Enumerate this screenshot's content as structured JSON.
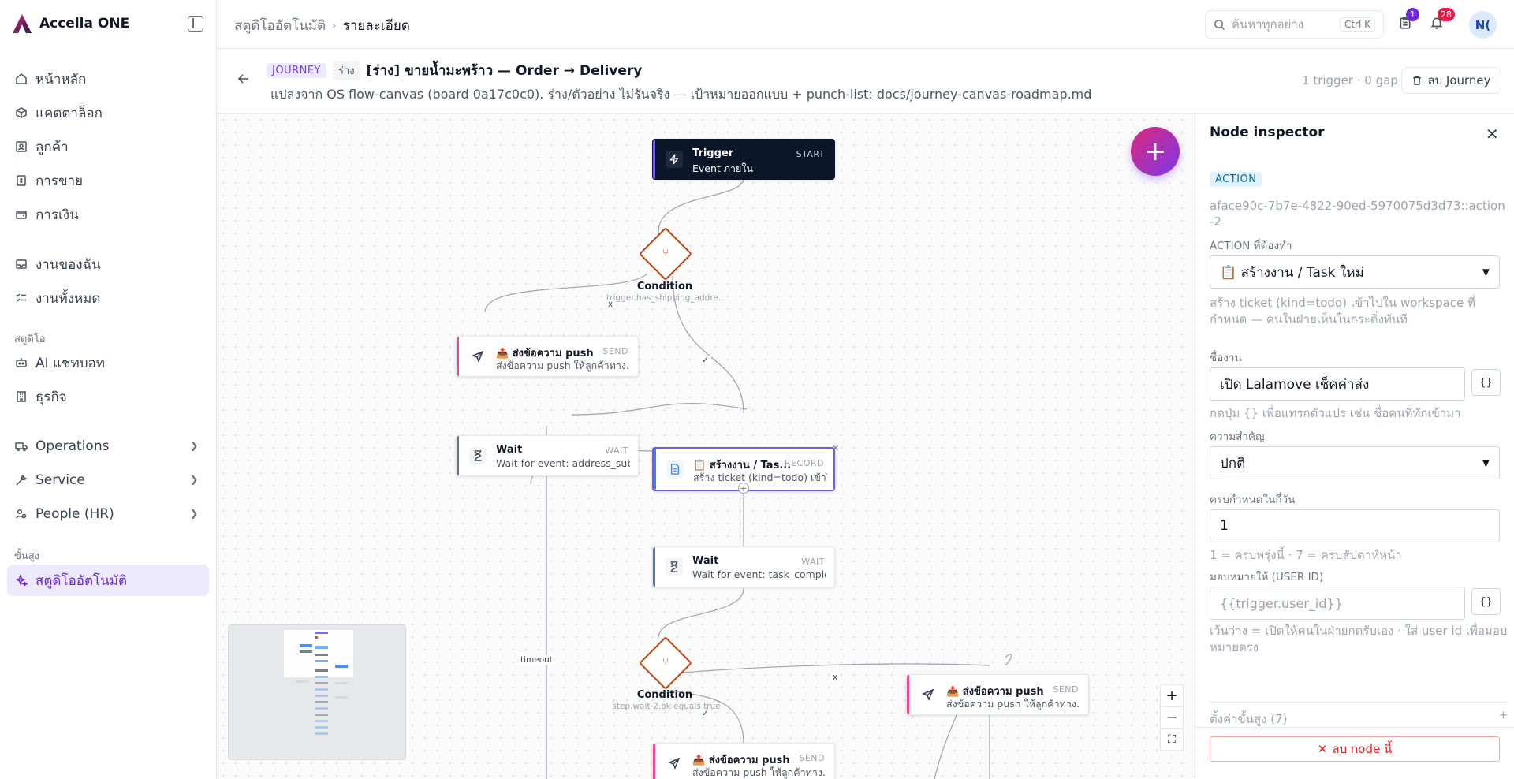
{
  "app": {
    "name": "Accella ONE"
  },
  "sidebar": {
    "items": [
      {
        "label": "หน้าหลัก",
        "icon": "home-icon"
      },
      {
        "label": "แคตตาล็อก",
        "icon": "box-icon"
      },
      {
        "label": "ลูกค้า",
        "icon": "contact-icon"
      },
      {
        "label": "การขาย",
        "icon": "receipt-icon"
      },
      {
        "label": "การเงิน",
        "icon": "wallet-icon"
      },
      {
        "label": "งานของฉัน",
        "icon": "inbox-icon"
      },
      {
        "label": "งานทั้งหมด",
        "icon": "list-check-icon"
      },
      {
        "label": "AI แชทบอท",
        "icon": "bot-icon"
      },
      {
        "label": "ธุรกิจ",
        "icon": "building-icon"
      },
      {
        "label": "Operations",
        "icon": "truck-icon"
      },
      {
        "label": "Service",
        "icon": "wrench-icon"
      },
      {
        "label": "People (HR)",
        "icon": "people-icon"
      },
      {
        "label": "สตูดิโออัตโนมัติ",
        "icon": "sparkle-icon"
      }
    ],
    "section_studio": "สตูดิโอ",
    "section_advanced": "ขั้นสูง"
  },
  "topbar": {
    "breadcrumb_root": "สตูดิโออัตโนมัติ",
    "breadcrumb_current": "รายละเอียด",
    "search_placeholder": "ค้นหาทุกอย่าง",
    "search_shortcut": "Ctrl K",
    "tasks_badge": "1",
    "notifications_badge": "28",
    "avatar_initials": "N("
  },
  "journey": {
    "tag": "JOURNEY",
    "status": "ร่าง",
    "title": "[ร่าง] ขายน้ำมะพร้าว — Order → Delivery",
    "subtitle": "แปลงจาก OS flow-canvas (board 0a17c0c0). ร่าง/ตัวอย่าง ไม่รันจริง — เป้าหมายออกแบบ + punch-list: docs/journey-canvas-roadmap.md",
    "meta": "1 trigger · 0 gap",
    "delete_label": "ลบ Journey"
  },
  "canvas": {
    "nodes": [
      {
        "title": "Trigger",
        "sub": "Event ภายใน",
        "tag": "START"
      },
      {
        "title": "📤 ส่งข้อความ push ...",
        "sub": "ส่งข้อความ push ให้ลูกค้าทาง...",
        "tag": "SEND"
      },
      {
        "title": "Wait",
        "sub": "Wait for event: address_sub...",
        "tag": "WAIT"
      },
      {
        "title": "📋 สร้างงาน / Tas...",
        "sub": "สร้าง ticket (kind=todo) เข้าไ...",
        "tag": "RECORD"
      },
      {
        "title": "Wait",
        "sub": "Wait for event: task_complet...",
        "tag": "WAIT"
      },
      {
        "title": "📤 ส่งข้อความ push ...",
        "sub": "ส่งข้อความ push ให้ลูกค้าทาง...",
        "tag": "SEND"
      },
      {
        "title": "📤 ส่งข้อความ push ...",
        "sub": "ส่งข้อความ push ให้ลูกค้าทาง...",
        "tag": "SEND"
      }
    ],
    "conditions": [
      {
        "label": "Condition",
        "sub": "trigger.has_shipping_addre..."
      },
      {
        "label": "Condition",
        "sub": "step.wait-2.ok equals true"
      }
    ],
    "edge_labels": {
      "no": "x",
      "yes": "✓",
      "timeout": "timeout"
    },
    "zoom_in": "+",
    "zoom_out": "−",
    "fit": "⛶",
    "add": "+"
  },
  "inspector": {
    "title": "Node inspector",
    "type_tag": "ACTION",
    "node_id": "aface90c-7b7e-4822-90ed-5970075d3d73::action-2",
    "action_label": "ACTION ที่ต้องทำ",
    "action_value": "📋 สร้างงาน / Task ใหม่",
    "action_hint": "สร้าง ticket (kind=todo) เข้าไปใน workspace ที่กำหนด — คนในฝ่ายเห็นในกระดิ่งทันที",
    "name_label": "ชื่องาน",
    "name_value": "เปิด Lalamove เช็คค่าส่ง",
    "name_hint": "กดปุ่ม {} เพื่อแทรกตัวแปร เช่น ชื่อคนที่ทักเข้ามา",
    "priority_label": "ความสำคัญ",
    "priority_value": "ปกติ",
    "due_label": "ครบกำหนดในกี่วัน",
    "due_value": "1",
    "due_hint": "1 = ครบพรุ่งนี้ · 7 = ครบสัปดาห์หน้า",
    "assign_label": "มอบหมายให้ (USER ID)",
    "assign_placeholder": "{{trigger.user_id}}",
    "assign_hint": "เว้นว่าง = เปิดให้คนในฝ่ายกดรับเอง · ใส่ user id เพื่อมอบหมายตรง",
    "brace": "{}",
    "advanced": "ตั้งค่าขั้นสูง (7)",
    "advanced_plus": "+",
    "delete_node": "ลบ node นี้",
    "close": "✕"
  },
  "colors": {
    "accent": "#7c3aed",
    "send_bar": "#ec4899",
    "wait_bar": "#64748b",
    "record_bar": "#3b82f6",
    "trigger_bg": "#0b1629",
    "condition": "#c2410c",
    "danger": "#dc2626"
  }
}
